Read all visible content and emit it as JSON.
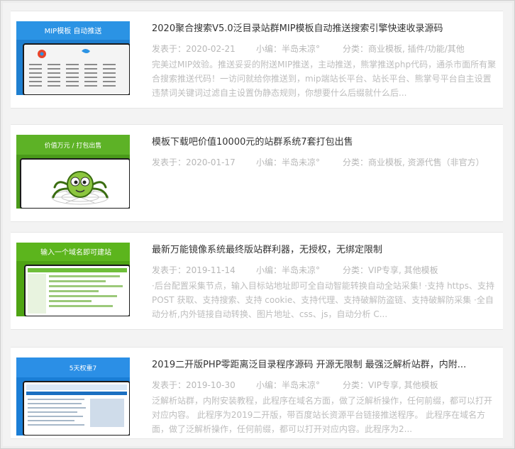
{
  "posts": [
    {
      "title": "2020聚合搜索V5.0泛目录站群MIP模板自动推送搜索引擎快速收录源码",
      "date_label": "发表于：",
      "date": "2020-02-21",
      "author_label": "小编：",
      "author": "半岛未凉°",
      "category_label": "分类：",
      "categories": [
        "商业模板",
        "插件/功能/其他"
      ],
      "excerpt": "完美过MIP效验。推送妥妥的附送MIP推送，主动推送，熊掌推送php代码，通杀市面所有聚合搜索推送代码！一访问就给你推送到，mip端站长平台、站长平台、熊掌号平台自主设置违禁词关键词过滤自主设置伪静态规则，你想要什么后缀就什么后...",
      "thumb": {
        "banner": "MIP模板  自动推送",
        "bg": "#1f7fd0",
        "accent": "#ffffff"
      }
    },
    {
      "title": "模板下载吧价值10000元的站群系统7套打包出售",
      "date_label": "发表于：",
      "date": "2020-01-17",
      "author_label": "小编：",
      "author": "半岛未凉°",
      "category_label": "分类：",
      "categories": [
        "商业模板",
        "资源代售（非官方）"
      ],
      "excerpt": "",
      "thumb": {
        "banner": "价值万元 / 打包出售",
        "bg": "#4a9a1a",
        "accent": "#ffffff"
      }
    },
    {
      "title": "最新万能镜像系统最终版站群利器，无授权，无绑定限制",
      "date_label": "发表于：",
      "date": "2019-11-14",
      "author_label": "小编：",
      "author": "半岛未凉°",
      "category_label": "分类：",
      "categories": [
        "VIP专享",
        "其他模板"
      ],
      "excerpt": "·后台配置采集节点，输入目标站地址即可全自动智能转换自动全站采集! ·支持 https、支持 POST 获取、支持搜索、支持 cookie、支持代理、支持破解防盗链、支持破解防采集 ·全自动分析,内外链接自动转换、图片地址、css、js，自动分析 C...",
      "thumb": {
        "banner": "输入一个域名即可建站",
        "bg": "#4ea313",
        "accent": "#ffffff"
      }
    },
    {
      "title": "2019二开版PHP零距离泛目录程序源码 开源无限制 最强泛解析站群，内附...",
      "date_label": "发表于：",
      "date": "2019-10-30",
      "author_label": "小编：",
      "author": "半岛未凉°",
      "category_label": "分类：",
      "categories": [
        "VIP专享",
        "其他模板"
      ],
      "excerpt": "泛解析站群，内附安装教程，此程序在域名方面，做了泛解析操作，任何前缀，都可以打开对应内容。 此程序为2019二开版，带百度站长资源平台链接推送程序。 此程序在域名方面，做了泛解析操作，任何前缀，都可以打开对应内容。此程序为2...",
      "thumb": {
        "banner": "5天权重7",
        "bg": "#1a7ed6",
        "accent": "#ffffff"
      }
    }
  ],
  "colors": {
    "title": "#333333",
    "meta": "#b7b7b7",
    "excerpt": "#bdbdbd",
    "card_bg": "#ffffff",
    "page_bg": "#f3f3f3"
  }
}
